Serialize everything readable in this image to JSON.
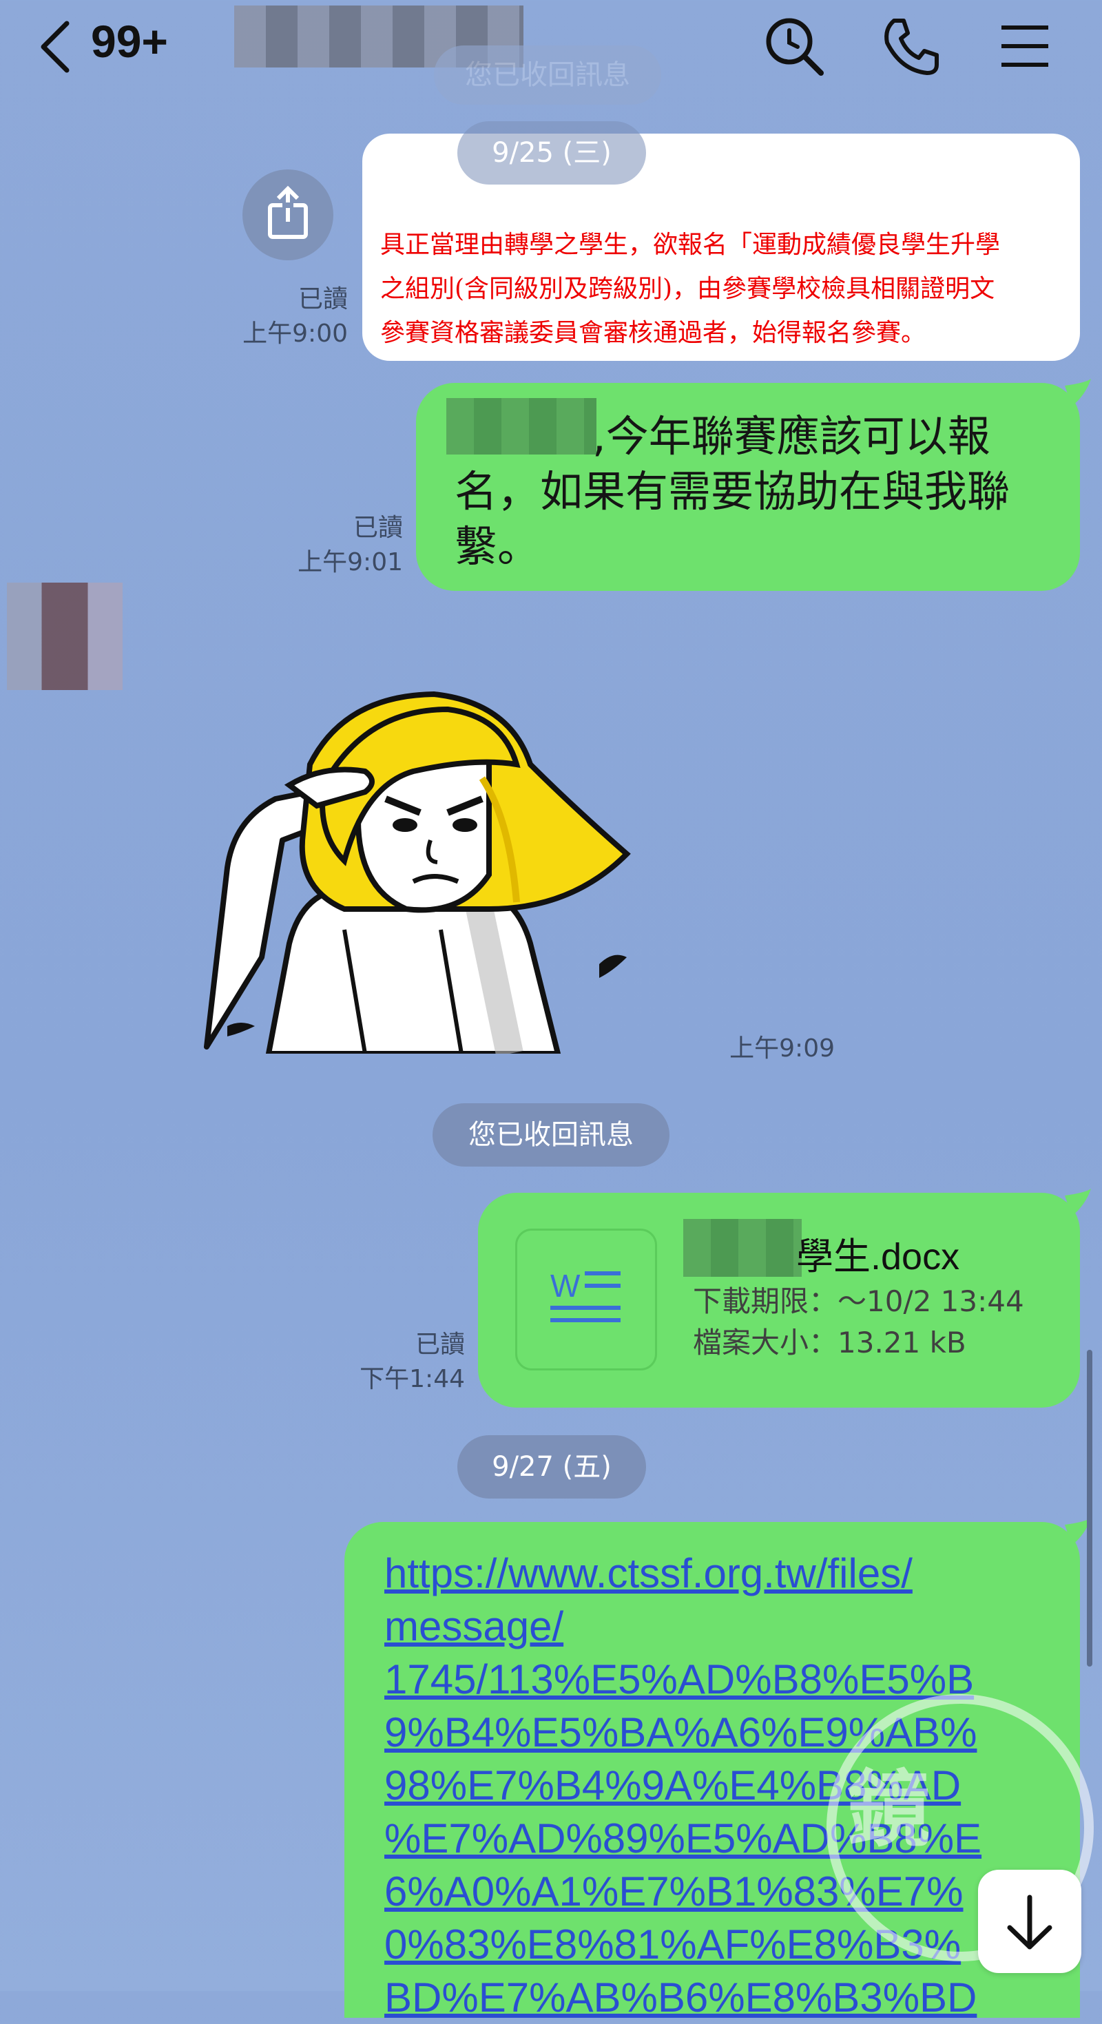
{
  "header": {
    "unread_count": "99+",
    "icons": [
      "chevron-left-icon",
      "search-icon",
      "phone-icon",
      "menu-icon"
    ]
  },
  "pills": {
    "recalled_top": "您已收回訊息",
    "date_1": "9/25 (三)",
    "recalled_mid": "您已收回訊息",
    "date_2": "9/27 (五)"
  },
  "messages": {
    "notice": {
      "lines": [
        "具正當理由轉學之學生，欲報名「運動成績優良學生升學",
        "之組別(含同級別及跨級別)，由參賽學校檢具相關證明文",
        "參賽資格審議委員會審核通過者，始得報名參賽。"
      ],
      "read": "已讀",
      "time": "上午9:00"
    },
    "reply": {
      "lines": [
        ",今年聯賽應該可以報",
        "名，如果有需要協助在與我聯",
        "繫。"
      ],
      "read": "已讀",
      "time": "上午9:01"
    },
    "sticker": {
      "time": "上午9:09"
    },
    "file": {
      "name_suffix": "學生.docx",
      "download_limit": "下載期限：～10/2 13:44",
      "file_size": "檔案大小：13.21 kB",
      "read": "已讀",
      "time": "下午1:44"
    },
    "link": {
      "lines": [
        "https://www.ctssf.org.tw/files/",
        "message/",
        "1745/113%E5%AD%B8%E5%B",
        "9%B4%E5%BA%A6%E9%AB%",
        "98%E7%B4%9A%E4%B8%AD",
        "%E7%AD%89%E5%AD%B8%E",
        "6%A0%A1%E7%B1%83%E7%",
        "0%83%E8%81%AF%E8%B3%",
        "BD%E7%AB%B6%E8%B3%BD"
      ]
    }
  },
  "colors": {
    "background": "#8ea9d9",
    "bubble_green": "#6ee16d",
    "pill": "#7c90b8",
    "link": "#2a4ed2",
    "notice_red": "#e00000"
  }
}
